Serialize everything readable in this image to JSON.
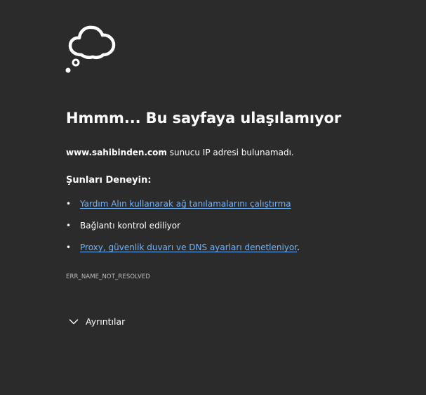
{
  "error_page": {
    "icon": "cloud-thought-icon",
    "title": "Hmmm... Bu sayfaya ulaşılamıyor",
    "host": "www.sahibinden.com",
    "description_suffix": " sunucu IP adresi bulunamadı.",
    "try_heading": "Şunları Deneyin:",
    "suggestions": [
      {
        "text": "Yardım Alın kullanarak ağ tanılamalarını çalıştırma",
        "link": true
      },
      {
        "text": "Bağlantı kontrol ediliyor",
        "link": false
      },
      {
        "text": "Proxy, güvenlik duvarı ve DNS ayarları denetleniyor",
        "link": true,
        "suffix": "."
      }
    ],
    "error_code": "ERR_NAME_NOT_RESOLVED",
    "details_label": "Ayrıntılar"
  },
  "colors": {
    "background": "#2b2b2b",
    "text": "#ffffff",
    "link": "#6cb4ff",
    "muted": "#bdbdbd"
  }
}
